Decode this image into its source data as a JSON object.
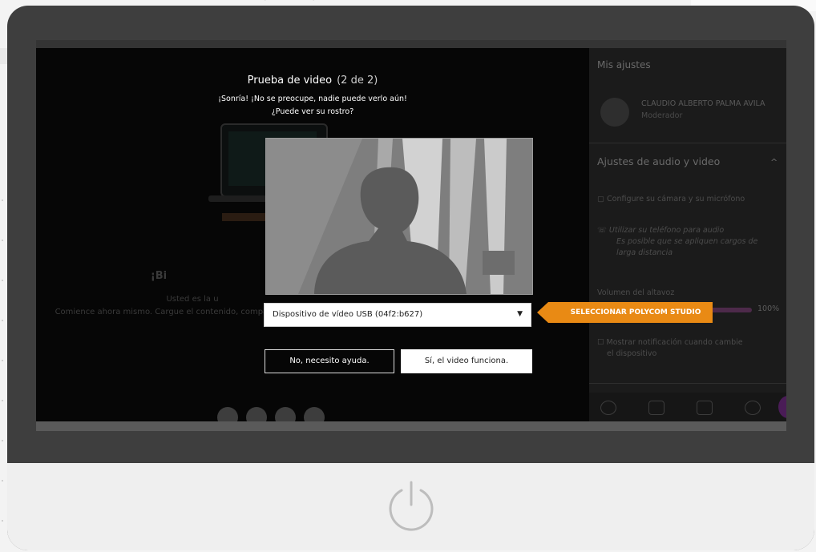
{
  "dialog": {
    "title": "Prueba de video",
    "step": "(2 de 2)",
    "subtitle1": "¡Sonría! ¡No se preocupe, nadie puede verlo aún!",
    "subtitle2": "¿Puede ver su rostro?",
    "device_select_value": "Dispositivo de vídeo USB (04f2:b627)",
    "no_button": "No, necesito ayuda.",
    "yes_button": "Sí, el video funciona."
  },
  "callout": {
    "label": "SELECCIONAR POLYCOM STUDIO",
    "color": "#e98a14"
  },
  "background_main": {
    "welcome_partial": "¡Bi",
    "line1_partial": "Usted es la u",
    "line2_partial": "Comience ahora mismo. Cargue el contenido, comparta el audio"
  },
  "sidebar": {
    "title": "Mis ajustes",
    "user_name": "CLAUDIO ALBERTO PALMA AVILA",
    "user_role": "Moderador",
    "section_title": "Ajustes de audio y video",
    "configure_label": "Configure su cámara y su micrófono",
    "phone_line1": "Utilizar su teléfono para audio",
    "phone_line2": "Es posible que se apliquen cargos de",
    "phone_line3": "larga distancia",
    "volume_label": "Volumen del altavoz",
    "volume_value": "100%",
    "notify_line1": "Mostrar notificación cuando cambie",
    "notify_line2": "el dispositivo",
    "accent_purple": "#4d2a4a"
  }
}
